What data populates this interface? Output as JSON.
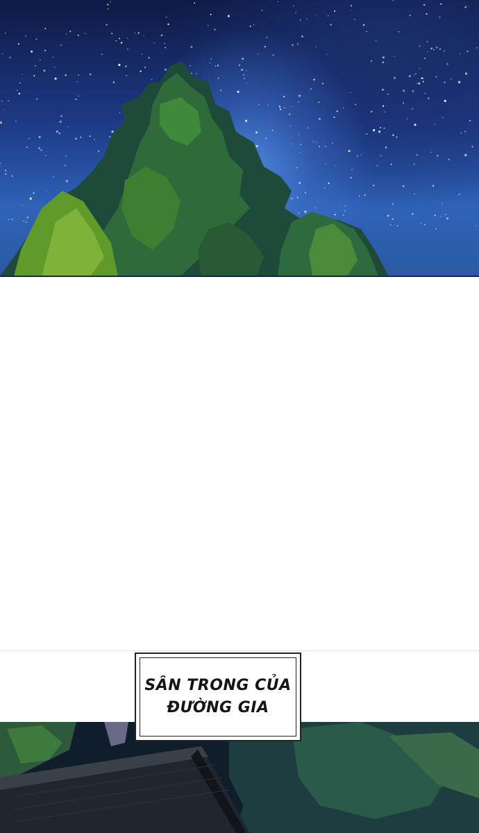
{
  "caption": {
    "line1": "SÂN TRONG CỦA",
    "line2": "ĐƯỜNG GIA"
  },
  "colors": {
    "sky_dark": "#0e1a44",
    "sky_glow": "#4a86d8",
    "foliage_light": "#5f9a2a",
    "foliage_dark": "#1f4a2a",
    "panel_border": "#222222"
  }
}
